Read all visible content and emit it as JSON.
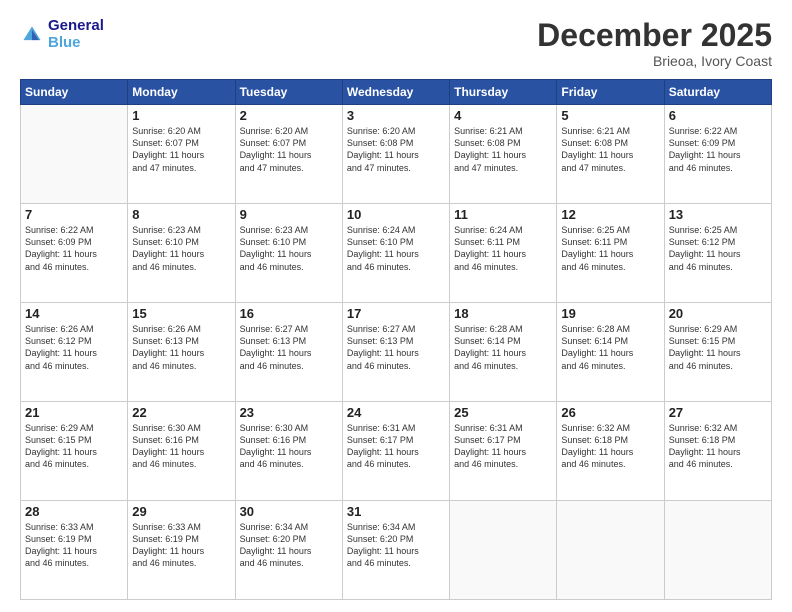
{
  "header": {
    "logo_line1": "General",
    "logo_line2": "Blue",
    "month": "December 2025",
    "location": "Brieoa, Ivory Coast"
  },
  "weekdays": [
    "Sunday",
    "Monday",
    "Tuesday",
    "Wednesday",
    "Thursday",
    "Friday",
    "Saturday"
  ],
  "weeks": [
    [
      {
        "day": "",
        "sunrise": "",
        "sunset": "",
        "daylight": ""
      },
      {
        "day": "1",
        "sunrise": "Sunrise: 6:20 AM",
        "sunset": "Sunset: 6:07 PM",
        "daylight": "Daylight: 11 hours and 47 minutes."
      },
      {
        "day": "2",
        "sunrise": "Sunrise: 6:20 AM",
        "sunset": "Sunset: 6:07 PM",
        "daylight": "Daylight: 11 hours and 47 minutes."
      },
      {
        "day": "3",
        "sunrise": "Sunrise: 6:20 AM",
        "sunset": "Sunset: 6:08 PM",
        "daylight": "Daylight: 11 hours and 47 minutes."
      },
      {
        "day": "4",
        "sunrise": "Sunrise: 6:21 AM",
        "sunset": "Sunset: 6:08 PM",
        "daylight": "Daylight: 11 hours and 47 minutes."
      },
      {
        "day": "5",
        "sunrise": "Sunrise: 6:21 AM",
        "sunset": "Sunset: 6:08 PM",
        "daylight": "Daylight: 11 hours and 47 minutes."
      },
      {
        "day": "6",
        "sunrise": "Sunrise: 6:22 AM",
        "sunset": "Sunset: 6:09 PM",
        "daylight": "Daylight: 11 hours and 46 minutes."
      }
    ],
    [
      {
        "day": "7",
        "sunrise": "Sunrise: 6:22 AM",
        "sunset": "Sunset: 6:09 PM",
        "daylight": "Daylight: 11 hours and 46 minutes."
      },
      {
        "day": "8",
        "sunrise": "Sunrise: 6:23 AM",
        "sunset": "Sunset: 6:10 PM",
        "daylight": "Daylight: 11 hours and 46 minutes."
      },
      {
        "day": "9",
        "sunrise": "Sunrise: 6:23 AM",
        "sunset": "Sunset: 6:10 PM",
        "daylight": "Daylight: 11 hours and 46 minutes."
      },
      {
        "day": "10",
        "sunrise": "Sunrise: 6:24 AM",
        "sunset": "Sunset: 6:10 PM",
        "daylight": "Daylight: 11 hours and 46 minutes."
      },
      {
        "day": "11",
        "sunrise": "Sunrise: 6:24 AM",
        "sunset": "Sunset: 6:11 PM",
        "daylight": "Daylight: 11 hours and 46 minutes."
      },
      {
        "day": "12",
        "sunrise": "Sunrise: 6:25 AM",
        "sunset": "Sunset: 6:11 PM",
        "daylight": "Daylight: 11 hours and 46 minutes."
      },
      {
        "day": "13",
        "sunrise": "Sunrise: 6:25 AM",
        "sunset": "Sunset: 6:12 PM",
        "daylight": "Daylight: 11 hours and 46 minutes."
      }
    ],
    [
      {
        "day": "14",
        "sunrise": "Sunrise: 6:26 AM",
        "sunset": "Sunset: 6:12 PM",
        "daylight": "Daylight: 11 hours and 46 minutes."
      },
      {
        "day": "15",
        "sunrise": "Sunrise: 6:26 AM",
        "sunset": "Sunset: 6:13 PM",
        "daylight": "Daylight: 11 hours and 46 minutes."
      },
      {
        "day": "16",
        "sunrise": "Sunrise: 6:27 AM",
        "sunset": "Sunset: 6:13 PM",
        "daylight": "Daylight: 11 hours and 46 minutes."
      },
      {
        "day": "17",
        "sunrise": "Sunrise: 6:27 AM",
        "sunset": "Sunset: 6:13 PM",
        "daylight": "Daylight: 11 hours and 46 minutes."
      },
      {
        "day": "18",
        "sunrise": "Sunrise: 6:28 AM",
        "sunset": "Sunset: 6:14 PM",
        "daylight": "Daylight: 11 hours and 46 minutes."
      },
      {
        "day": "19",
        "sunrise": "Sunrise: 6:28 AM",
        "sunset": "Sunset: 6:14 PM",
        "daylight": "Daylight: 11 hours and 46 minutes."
      },
      {
        "day": "20",
        "sunrise": "Sunrise: 6:29 AM",
        "sunset": "Sunset: 6:15 PM",
        "daylight": "Daylight: 11 hours and 46 minutes."
      }
    ],
    [
      {
        "day": "21",
        "sunrise": "Sunrise: 6:29 AM",
        "sunset": "Sunset: 6:15 PM",
        "daylight": "Daylight: 11 hours and 46 minutes."
      },
      {
        "day": "22",
        "sunrise": "Sunrise: 6:30 AM",
        "sunset": "Sunset: 6:16 PM",
        "daylight": "Daylight: 11 hours and 46 minutes."
      },
      {
        "day": "23",
        "sunrise": "Sunrise: 6:30 AM",
        "sunset": "Sunset: 6:16 PM",
        "daylight": "Daylight: 11 hours and 46 minutes."
      },
      {
        "day": "24",
        "sunrise": "Sunrise: 6:31 AM",
        "sunset": "Sunset: 6:17 PM",
        "daylight": "Daylight: 11 hours and 46 minutes."
      },
      {
        "day": "25",
        "sunrise": "Sunrise: 6:31 AM",
        "sunset": "Sunset: 6:17 PM",
        "daylight": "Daylight: 11 hours and 46 minutes."
      },
      {
        "day": "26",
        "sunrise": "Sunrise: 6:32 AM",
        "sunset": "Sunset: 6:18 PM",
        "daylight": "Daylight: 11 hours and 46 minutes."
      },
      {
        "day": "27",
        "sunrise": "Sunrise: 6:32 AM",
        "sunset": "Sunset: 6:18 PM",
        "daylight": "Daylight: 11 hours and 46 minutes."
      }
    ],
    [
      {
        "day": "28",
        "sunrise": "Sunrise: 6:33 AM",
        "sunset": "Sunset: 6:19 PM",
        "daylight": "Daylight: 11 hours and 46 minutes."
      },
      {
        "day": "29",
        "sunrise": "Sunrise: 6:33 AM",
        "sunset": "Sunset: 6:19 PM",
        "daylight": "Daylight: 11 hours and 46 minutes."
      },
      {
        "day": "30",
        "sunrise": "Sunrise: 6:34 AM",
        "sunset": "Sunset: 6:20 PM",
        "daylight": "Daylight: 11 hours and 46 minutes."
      },
      {
        "day": "31",
        "sunrise": "Sunrise: 6:34 AM",
        "sunset": "Sunset: 6:20 PM",
        "daylight": "Daylight: 11 hours and 46 minutes."
      },
      {
        "day": "",
        "sunrise": "",
        "sunset": "",
        "daylight": ""
      },
      {
        "day": "",
        "sunrise": "",
        "sunset": "",
        "daylight": ""
      },
      {
        "day": "",
        "sunrise": "",
        "sunset": "",
        "daylight": ""
      }
    ]
  ]
}
